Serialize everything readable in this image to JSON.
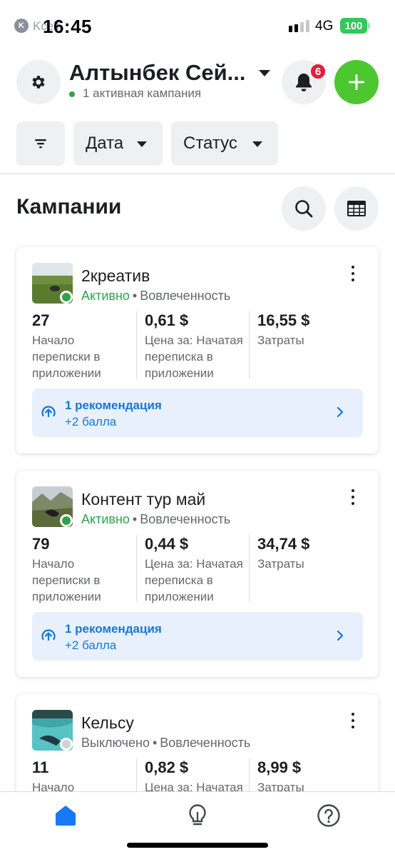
{
  "status_bar": {
    "time": "16:45",
    "carrier": "Kcell",
    "network": "4G",
    "battery": "100"
  },
  "header": {
    "account_name": "Алтынбек Сей...",
    "account_status": "1 активная кампания",
    "notifications_count": "6"
  },
  "filters": {
    "date_label": "Дата",
    "status_label": "Статус"
  },
  "section": {
    "title": "Кампании"
  },
  "campaigns": [
    {
      "name": "2креатив",
      "status": "Активно",
      "status_color": "#31a24c",
      "objective": "Вовлеченность",
      "metrics": [
        {
          "value": "27",
          "label": "Начало\nпереписки в\nприложении"
        },
        {
          "value": "0,61 $",
          "label": "Цена за: Начатая\nпереписка в\nприложении"
        },
        {
          "value": "16,55 $",
          "label": "Затраты"
        }
      ],
      "recommendation": {
        "title": "1 рекомендация",
        "subtitle": "+2 балла"
      }
    },
    {
      "name": "Контент тур май",
      "status": "Активно",
      "status_color": "#31a24c",
      "objective": "Вовлеченность",
      "metrics": [
        {
          "value": "79",
          "label": "Начало\nпереписки в\nприложении"
        },
        {
          "value": "0,44 $",
          "label": "Цена за: Начатая\nпереписка в\nприложении"
        },
        {
          "value": "34,74 $",
          "label": "Затраты"
        }
      ],
      "recommendation": {
        "title": "1 рекомендация",
        "subtitle": "+2 балла"
      }
    },
    {
      "name": "Кельсу",
      "status": "Выключено",
      "status_color": "#65676b",
      "objective": "Вовлеченность",
      "metrics": [
        {
          "value": "11",
          "label": "Начало"
        },
        {
          "value": "0,82 $",
          "label": "Цена за: Начатая"
        },
        {
          "value": "8,99 $",
          "label": "Затраты"
        }
      ]
    }
  ],
  "colors": {
    "accent_green": "#4cc72f",
    "active_green": "#31a24c",
    "link_blue": "#1877d4",
    "nav_active": "#1877f2",
    "badge_red": "#e41e3f"
  },
  "nav": {
    "items": [
      "home-icon",
      "lightbulb-icon",
      "help-icon"
    ],
    "active": "home-icon"
  }
}
